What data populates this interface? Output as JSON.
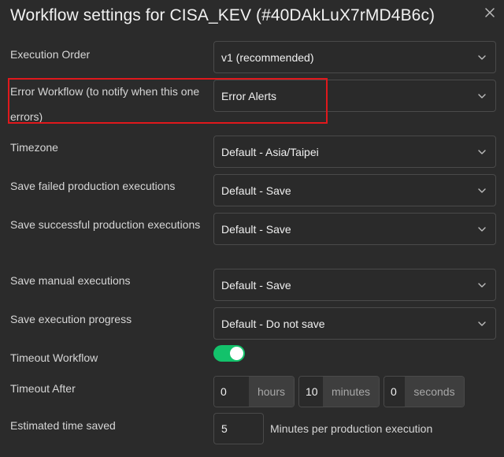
{
  "dialog": {
    "title": "Workflow settings for CISA_KEV (#40DAkLuX7rMD4B6c)"
  },
  "settings": {
    "execution_order": {
      "label": "Execution Order",
      "value": "v1 (recommended)"
    },
    "error_workflow": {
      "label": "Error Workflow (to notify when this one errors)",
      "value": "Error Alerts"
    },
    "timezone": {
      "label": "Timezone",
      "value": "Default - Asia/Taipei"
    },
    "save_failed": {
      "label": "Save failed production executions",
      "value": "Default - Save"
    },
    "save_successful": {
      "label": "Save successful production executions",
      "value": "Default - Save"
    },
    "save_manual": {
      "label": "Save manual executions",
      "value": "Default - Save"
    },
    "save_progress": {
      "label": "Save execution progress",
      "value": "Default - Do not save"
    },
    "timeout_workflow": {
      "label": "Timeout Workflow",
      "enabled": true
    },
    "timeout_after": {
      "label": "Timeout After",
      "hours": {
        "value": "0",
        "unit": "hours"
      },
      "minutes": {
        "value": "10",
        "unit": "minutes"
      },
      "seconds": {
        "value": "0",
        "unit": "seconds"
      }
    },
    "estimated_time_saved": {
      "label": "Estimated time saved",
      "value": "5",
      "suffix": "Minutes per production execution"
    }
  },
  "colors": {
    "background": "#2b2b2b",
    "highlight_border": "#e0181c",
    "toggle_on": "#13c26b"
  },
  "icons": {
    "close": "close-icon",
    "dropdown": "chevron-down-icon"
  }
}
